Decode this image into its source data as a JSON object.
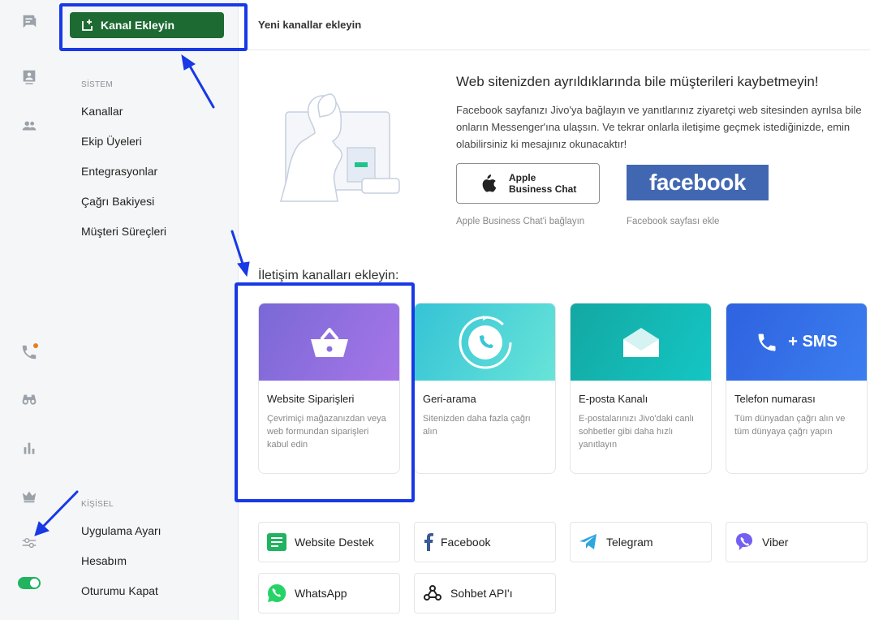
{
  "rail": {
    "icons": [
      "chat-icon",
      "visitors-icon",
      "contacts-icon",
      "calls-icon",
      "binoculars-icon",
      "reports-icon",
      "crown-icon",
      "settings-sliders-icon",
      "status-toggle"
    ]
  },
  "settings": {
    "add_channel_label": "Kanal Ekleyin",
    "system_label": "SİSTEM",
    "system_items": [
      "Kanallar",
      "Ekip Üyeleri",
      "Entegrasyonlar",
      "Çağrı Bakiyesi",
      "Müşteri Süreçleri"
    ],
    "personal_label": "KİŞİSEL",
    "personal_items": [
      "Uygulama Ayarı",
      "Hesabım",
      "Oturumu Kapat"
    ]
  },
  "main": {
    "page_title": "Yeni kanallar ekleyin",
    "hero_title": "Web sitenizden ayrıldıklarında bile müşterileri kaybetmeyin!",
    "hero_desc": "Facebook sayfanızı Jivo'ya bağlayın ve yanıtlarınız ziyaretçi web sitesinden ayrılsa bile onların Messenger'ına ulaşsın. Ve tekrar onlarla iletişime geçmek istediğinizde, emin olabilirsiniz ki mesajınız okunacaktır!",
    "apple_btn_line1": "Apple",
    "apple_btn_line2": "Business Chat",
    "facebook_btn_label": "facebook",
    "apple_link": "Apple Business Chat'i bağlayın",
    "facebook_link": "Facebook sayfası ekle",
    "section_title": "İletişim kanalları ekleyin:",
    "cards": [
      {
        "title": "Website Siparişleri",
        "desc": "Çevrimiçi mağazanızdan veya web formundan siparişleri kabul edin"
      },
      {
        "title": "Geri-arama",
        "desc": "Sitenizden daha fazla çağrı alın"
      },
      {
        "title": "E-posta Kanalı",
        "desc": "E-postalarınızı Jivo'daki canlı sohbetler gibi daha hızlı yanıtlayın"
      },
      {
        "title": "Telefon numarası",
        "desc": "Tüm dünyadan çağrı alın ve tüm dünyaya çağrı yapın",
        "banner": "+ SMS"
      }
    ],
    "channels": [
      "Website Destek",
      "Facebook",
      "Telegram",
      "Viber",
      "WhatsApp",
      "Sohbet API'ı"
    ]
  },
  "colors": {
    "accent_green": "#1e6a33",
    "highlight_blue": "#1739e6",
    "facebook_blue": "#4267b2"
  }
}
